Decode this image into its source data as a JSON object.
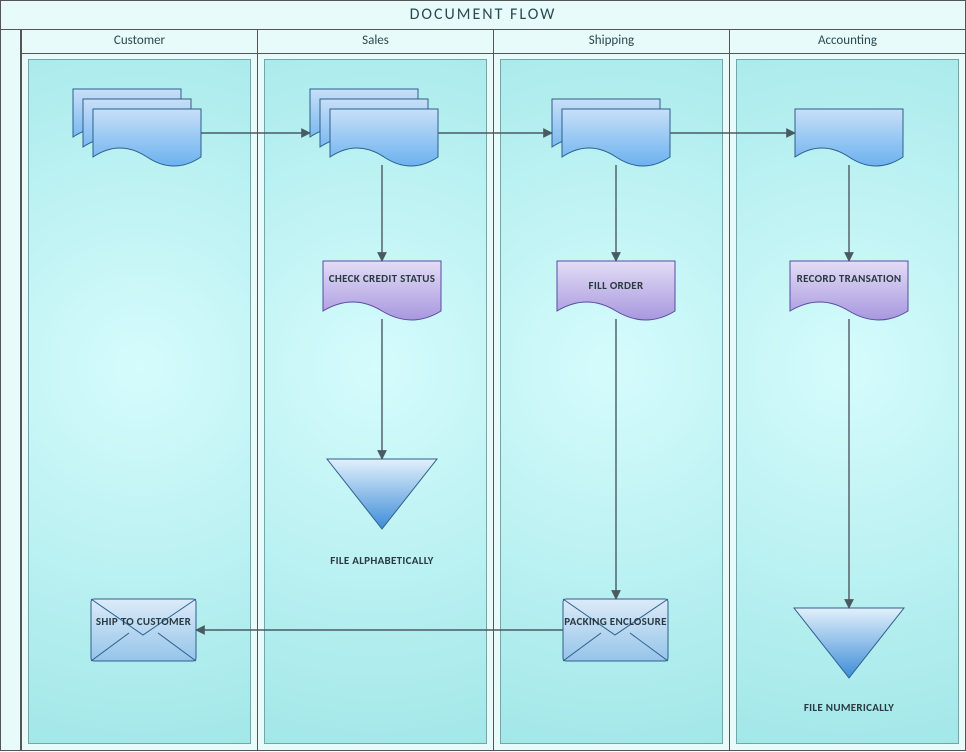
{
  "title": "DOCUMENT FLOW",
  "lanes": {
    "l0": "Customer",
    "l1": "Sales",
    "l2": "Shipping",
    "l3": "Accounting"
  },
  "nodes": {
    "check_credit": "CHECK CREDIT STATUS",
    "fill_order": "FILL ORDER",
    "record_tx": "RECORD TRANSATION",
    "file_alpha": "FILE ALPHABETICALLY",
    "file_num": "FILE NUMERICALLY",
    "ship_to": "SHIP TO CUSTOMER",
    "packing": "PACKING ENCLOSURE"
  },
  "chart_data": {
    "type": "swimlane-flowchart",
    "title": "DOCUMENT FLOW",
    "lanes": [
      "Customer",
      "Sales",
      "Shipping",
      "Accounting"
    ],
    "nodes": [
      {
        "id": "doc_customer",
        "lane": "Customer",
        "type": "multi-document",
        "label": ""
      },
      {
        "id": "doc_sales",
        "lane": "Sales",
        "type": "multi-document",
        "label": ""
      },
      {
        "id": "doc_shipping",
        "lane": "Shipping",
        "type": "multi-document",
        "label": ""
      },
      {
        "id": "doc_accounting",
        "lane": "Accounting",
        "type": "document",
        "label": ""
      },
      {
        "id": "check_credit",
        "lane": "Sales",
        "type": "process-document",
        "label": "CHECK CREDIT STATUS"
      },
      {
        "id": "fill_order",
        "lane": "Shipping",
        "type": "process-document",
        "label": "FILL ORDER"
      },
      {
        "id": "record_tx",
        "lane": "Accounting",
        "type": "process-document",
        "label": "RECORD TRANSATION"
      },
      {
        "id": "file_alpha",
        "lane": "Sales",
        "type": "storage-triangle",
        "label": "FILE ALPHABETICALLY"
      },
      {
        "id": "file_num",
        "lane": "Accounting",
        "type": "storage-triangle",
        "label": "FILE NUMERICALLY"
      },
      {
        "id": "packing",
        "lane": "Shipping",
        "type": "envelope",
        "label": "PACKING ENCLOSURE"
      },
      {
        "id": "ship_to",
        "lane": "Customer",
        "type": "envelope",
        "label": "SHIP TO CUSTOMER"
      }
    ],
    "edges": [
      {
        "from": "doc_customer",
        "to": "doc_sales"
      },
      {
        "from": "doc_sales",
        "to": "doc_shipping"
      },
      {
        "from": "doc_shipping",
        "to": "doc_accounting"
      },
      {
        "from": "doc_sales",
        "to": "check_credit"
      },
      {
        "from": "check_credit",
        "to": "file_alpha"
      },
      {
        "from": "doc_shipping",
        "to": "fill_order"
      },
      {
        "from": "fill_order",
        "to": "packing"
      },
      {
        "from": "doc_accounting",
        "to": "record_tx"
      },
      {
        "from": "record_tx",
        "to": "file_num"
      },
      {
        "from": "packing",
        "to": "ship_to"
      }
    ]
  }
}
